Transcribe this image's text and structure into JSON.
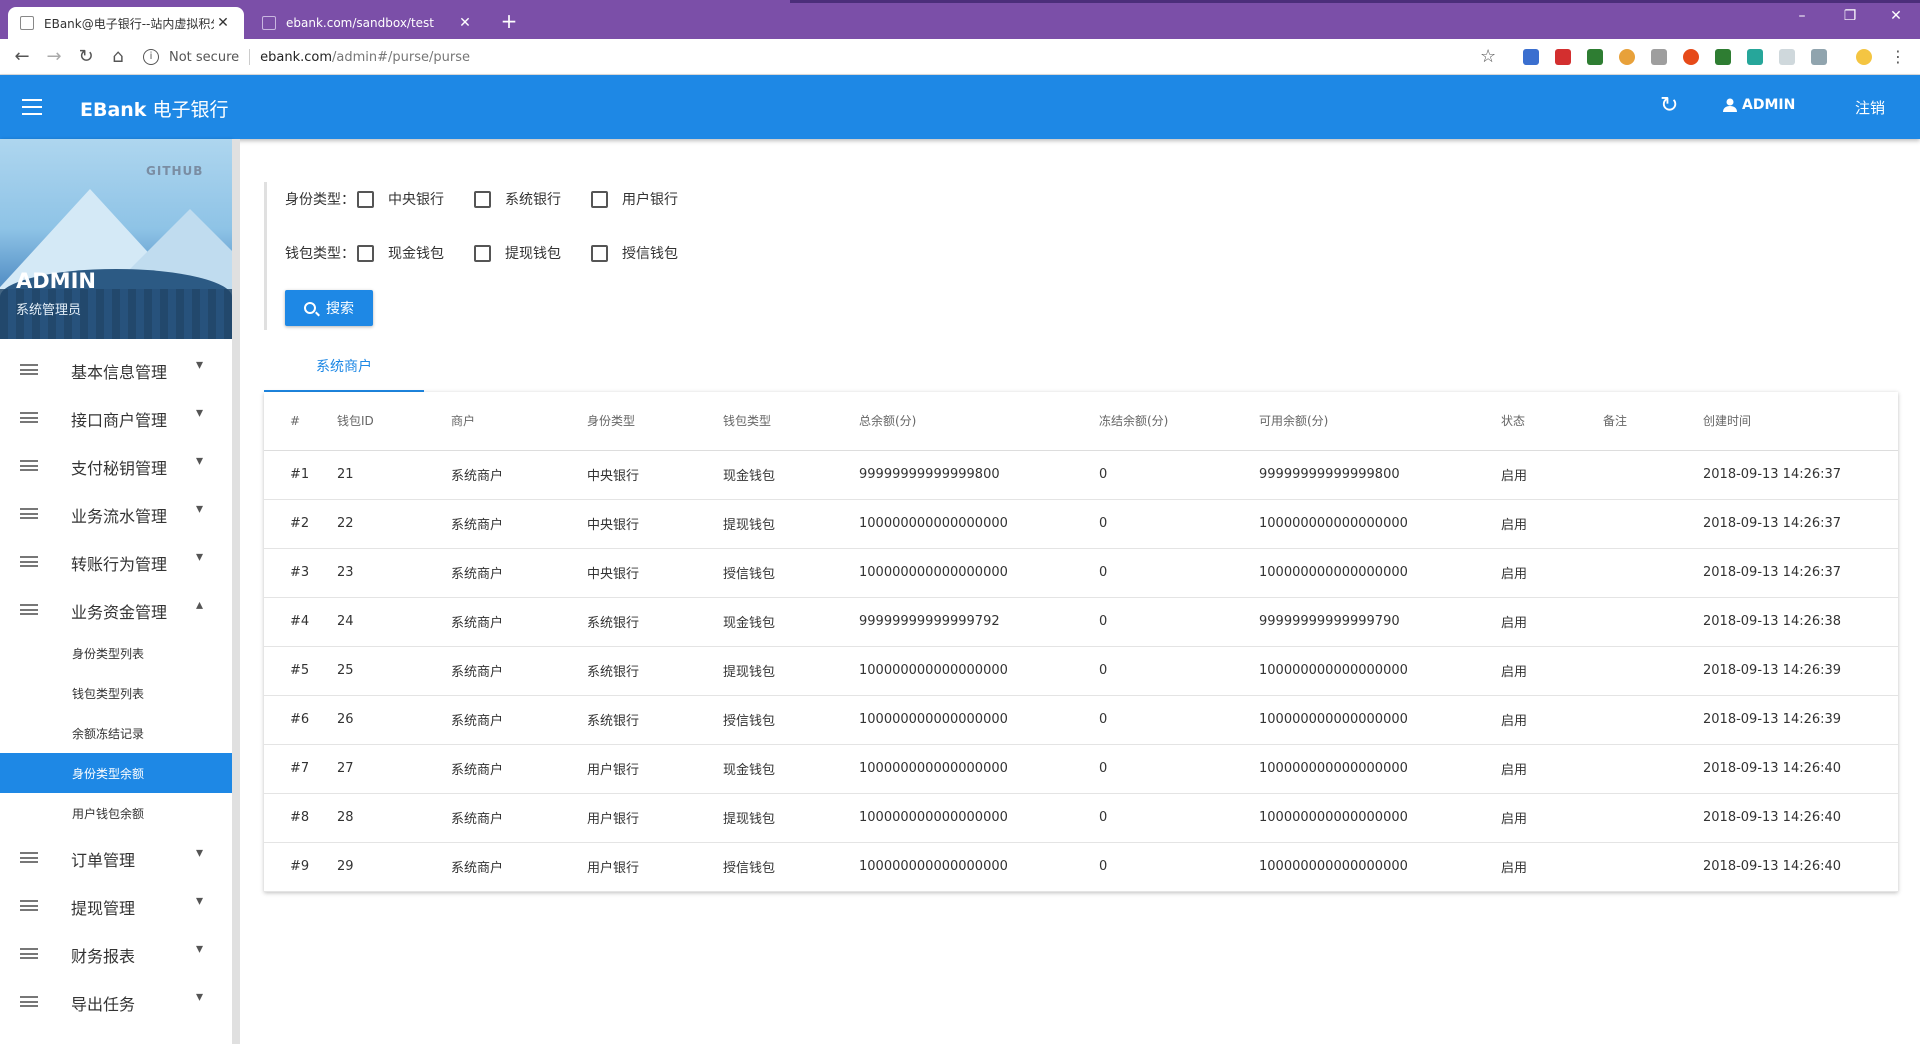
{
  "browser": {
    "tabs": [
      {
        "title": "EBank@电子银行--站内虚拟积分",
        "active": true
      },
      {
        "title": "ebank.com/sandbox/test",
        "active": false
      }
    ],
    "security_label": "Not secure",
    "url_host": "ebank.com",
    "url_path": "/admin#/purse/purse",
    "colors": {
      "chrome": "#7b4fa8"
    }
  },
  "header": {
    "brand_bold": "EBank",
    "brand_rest": " 电子银行",
    "user": "ADMIN",
    "logout": "注销",
    "color": "#1e88e5"
  },
  "profile": {
    "github": "GITHUB",
    "name": "ADMIN",
    "role": "系统管理员"
  },
  "menu": [
    {
      "label": "基本信息管理",
      "expanded": false
    },
    {
      "label": "接口商户管理",
      "expanded": false
    },
    {
      "label": "支付秘钥管理",
      "expanded": false
    },
    {
      "label": "业务流水管理",
      "expanded": false
    },
    {
      "label": "转账行为管理",
      "expanded": false
    },
    {
      "label": "业务资金管理",
      "expanded": true
    },
    {
      "label": "订单管理",
      "expanded": false
    },
    {
      "label": "提现管理",
      "expanded": false
    },
    {
      "label": "财务报表",
      "expanded": false
    },
    {
      "label": "导出任务",
      "expanded": false
    }
  ],
  "submenu": [
    {
      "label": "身份类型列表",
      "active": false
    },
    {
      "label": "钱包类型列表",
      "active": false
    },
    {
      "label": "余额冻结记录",
      "active": false
    },
    {
      "label": "身份类型余额",
      "active": true
    },
    {
      "label": "用户钱包余额",
      "active": false
    }
  ],
  "filters": {
    "identity_label": "身份类型：",
    "identity_options": [
      "中央银行",
      "系统银行",
      "用户银行"
    ],
    "wallet_label": "钱包类型：",
    "wallet_options": [
      "现金钱包",
      "提现钱包",
      "授信钱包"
    ],
    "search_button": "搜索"
  },
  "tab": "系统商户",
  "table": {
    "columns": [
      "#",
      "钱包ID",
      "商户",
      "身份类型",
      "钱包类型",
      "总余额(分)",
      "冻结余额(分)",
      "可用余额(分)",
      "状态",
      "备注",
      "创建时间"
    ],
    "rows": [
      [
        "#1",
        "21",
        "系统商户",
        "中央银行",
        "现金钱包",
        "99999999999999800",
        "0",
        "99999999999999800",
        "启用",
        "",
        "2018-09-13 14:26:37"
      ],
      [
        "#2",
        "22",
        "系统商户",
        "中央银行",
        "提现钱包",
        "100000000000000000",
        "0",
        "100000000000000000",
        "启用",
        "",
        "2018-09-13 14:26:37"
      ],
      [
        "#3",
        "23",
        "系统商户",
        "中央银行",
        "授信钱包",
        "100000000000000000",
        "0",
        "100000000000000000",
        "启用",
        "",
        "2018-09-13 14:26:37"
      ],
      [
        "#4",
        "24",
        "系统商户",
        "系统银行",
        "现金钱包",
        "99999999999999792",
        "0",
        "99999999999999790",
        "启用",
        "",
        "2018-09-13 14:26:38"
      ],
      [
        "#5",
        "25",
        "系统商户",
        "系统银行",
        "提现钱包",
        "100000000000000000",
        "0",
        "100000000000000000",
        "启用",
        "",
        "2018-09-13 14:26:39"
      ],
      [
        "#6",
        "26",
        "系统商户",
        "系统银行",
        "授信钱包",
        "100000000000000000",
        "0",
        "100000000000000000",
        "启用",
        "",
        "2018-09-13 14:26:39"
      ],
      [
        "#7",
        "27",
        "系统商户",
        "用户银行",
        "现金钱包",
        "100000000000000000",
        "0",
        "100000000000000000",
        "启用",
        "",
        "2018-09-13 14:26:40"
      ],
      [
        "#8",
        "28",
        "系统商户",
        "用户银行",
        "提现钱包",
        "100000000000000000",
        "0",
        "100000000000000000",
        "启用",
        "",
        "2018-09-13 14:26:40"
      ],
      [
        "#9",
        "29",
        "系统商户",
        "用户银行",
        "授信钱包",
        "100000000000000000",
        "0",
        "100000000000000000",
        "启用",
        "",
        "2018-09-13 14:26:40"
      ]
    ]
  }
}
